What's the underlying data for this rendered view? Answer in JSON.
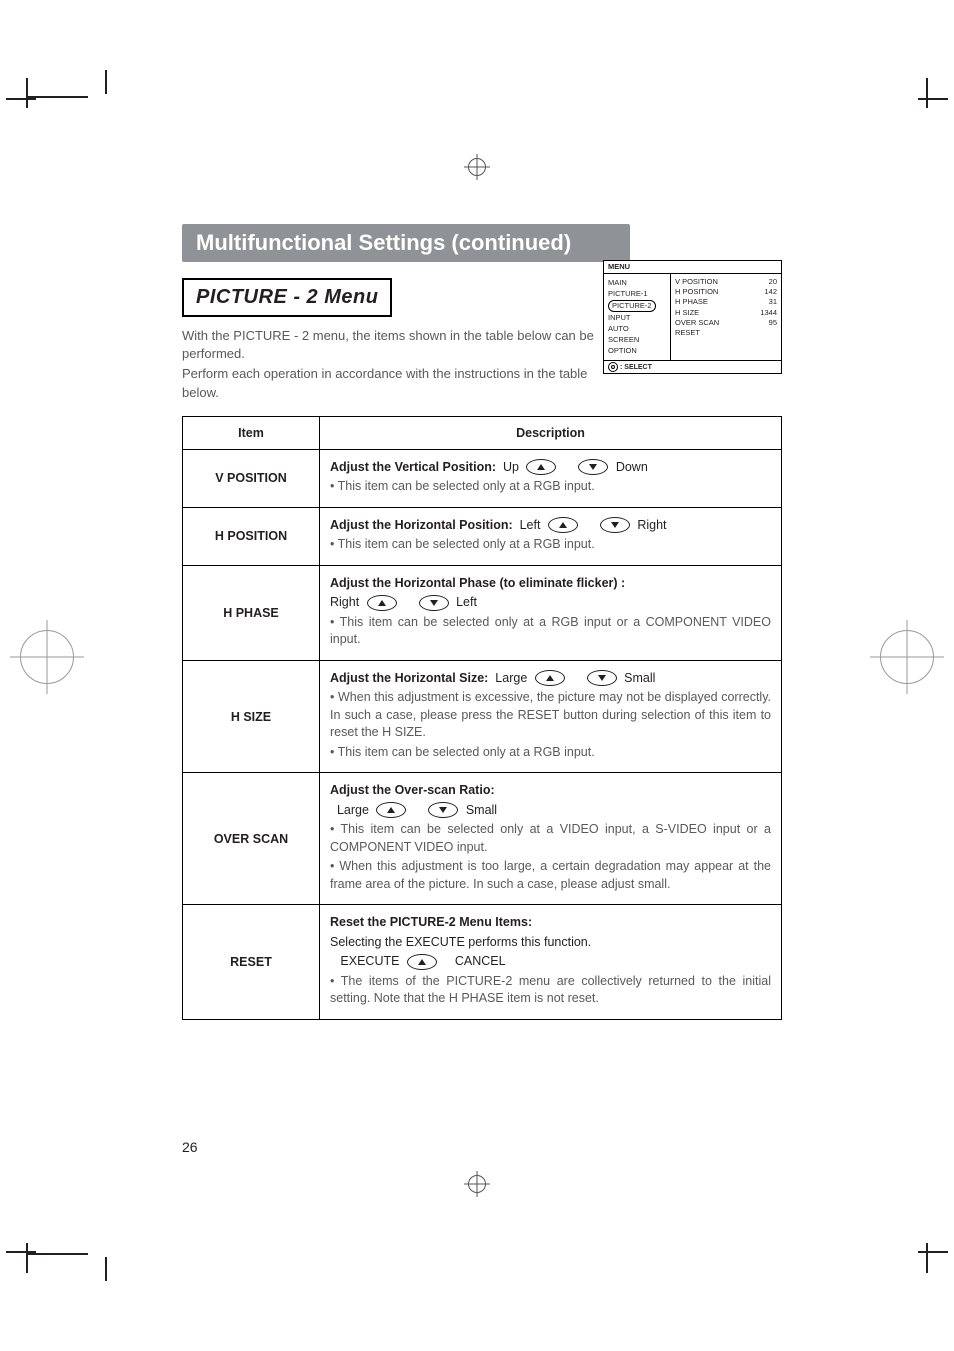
{
  "banner": "Multifunctional Settings (continued)",
  "section_title": "PICTURE - 2 Menu",
  "intro": [
    "With the PICTURE - 2 menu, the items shown in the table below can be performed.",
    "Perform each operation in accordance with the instructions in the table below."
  ],
  "osd": {
    "title": "MENU",
    "left": [
      "MAIN",
      "PICTURE-1",
      "PICTURE-2",
      "INPUT",
      "AUTO",
      "SCREEN",
      "OPTION"
    ],
    "right": [
      {
        "label": "V POSITION",
        "value": "20"
      },
      {
        "label": "H POSITION",
        "value": "142"
      },
      {
        "label": "H PHASE",
        "value": "31"
      },
      {
        "label": "H SIZE",
        "value": "1344"
      },
      {
        "label": "OVER SCAN",
        "value": "95"
      },
      {
        "label": "RESET",
        "value": ""
      }
    ],
    "footer": ": SELECT"
  },
  "table": {
    "headers": [
      "Item",
      "Description"
    ],
    "rows": [
      {
        "item": "V POSITION",
        "lead": "Adjust the Vertical Position:",
        "dir_a": "Up",
        "dir_b": "Down",
        "note1": "• This item can be selected only at a RGB input."
      },
      {
        "item": "H POSITION",
        "lead": "Adjust the Horizontal Position:",
        "dir_a": "Left",
        "dir_b": "Right",
        "note1": "• This item can be selected only at a RGB input."
      },
      {
        "item": "H PHASE",
        "lead": "Adjust the Horizontal Phase (to eliminate flicker) :",
        "dir_a": "Right",
        "dir_b": "Left",
        "note1": "• This item can be selected only at a RGB input or a COMPONENT VIDEO input."
      },
      {
        "item": "H SIZE",
        "lead": "Adjust the Horizontal Size:",
        "dir_a": "Large",
        "dir_b": "Small",
        "note1": "• When this adjustment is excessive, the picture may not be displayed correctly. In such a case, please press the RESET button during selection of this item to reset the H SIZE.",
        "note2": "• This item can be selected only at a RGB input."
      },
      {
        "item": "OVER SCAN",
        "lead": "Adjust the Over-scan Ratio:",
        "dir_a": "Large",
        "dir_b": "Small",
        "note1": "• This item can be selected only at a VIDEO input, a S-VIDEO input or a COMPONENT VIDEO input.",
        "note2": "• When this adjustment is too large, a certain degradation may appear at the frame area of the picture. In such a case, please adjust small."
      },
      {
        "item": "RESET",
        "lead": "Reset the PICTURE-2 Menu Items:",
        "sub": "Selecting the EXECUTE performs this function.",
        "dir_a": "EXECUTE",
        "dir_b": "CANCEL",
        "note1": "• The items of the PICTURE-2 menu are collectively returned to the initial setting. Note that the H PHASE item is not reset."
      }
    ]
  },
  "page_number": "26"
}
